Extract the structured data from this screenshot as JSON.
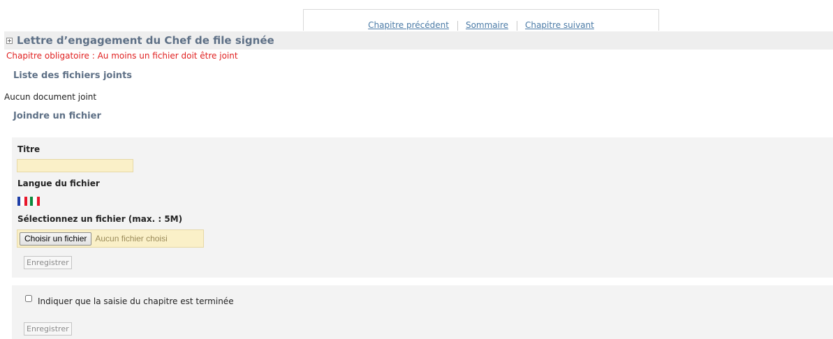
{
  "nav": {
    "previous": "Chapitre précédent",
    "summary": "Sommaire",
    "next": "Chapitre suivant"
  },
  "chapter": {
    "title": "Lettre d’engagement du Chef de file signée",
    "mandatory_notice": "Chapitre obligatoire : Au moins un fichier doit être joint"
  },
  "attached": {
    "heading": "Liste des fichiers joints",
    "empty_text": "Aucun document joint"
  },
  "upload": {
    "heading": "Joindre un fichier",
    "title_label": "Titre",
    "title_value": "",
    "language_label": "Langue du fichier",
    "flags": [
      {
        "name": "french-flag-icon",
        "colors": [
          "#1f3fa8",
          "#ffffff",
          "#e8162a"
        ]
      },
      {
        "name": "italian-flag-icon",
        "colors": [
          "#0c8a3c",
          "#ffffff",
          "#e8162a"
        ]
      }
    ],
    "file_label": "Sélectionnez un fichier (max. : 5M)",
    "choose_button": "Choisir un fichier",
    "no_file_text": "Aucun fichier choisi",
    "save_button": "Enregistrer"
  },
  "completion": {
    "checkbox_label": "Indiquer que la saisie du chapitre est terminée",
    "checked": false,
    "save_button": "Enregistrer"
  },
  "colors": {
    "heading": "#5e7086",
    "error": "#e02020",
    "link": "#4a7aa6",
    "input_bg": "#faf0c8"
  }
}
